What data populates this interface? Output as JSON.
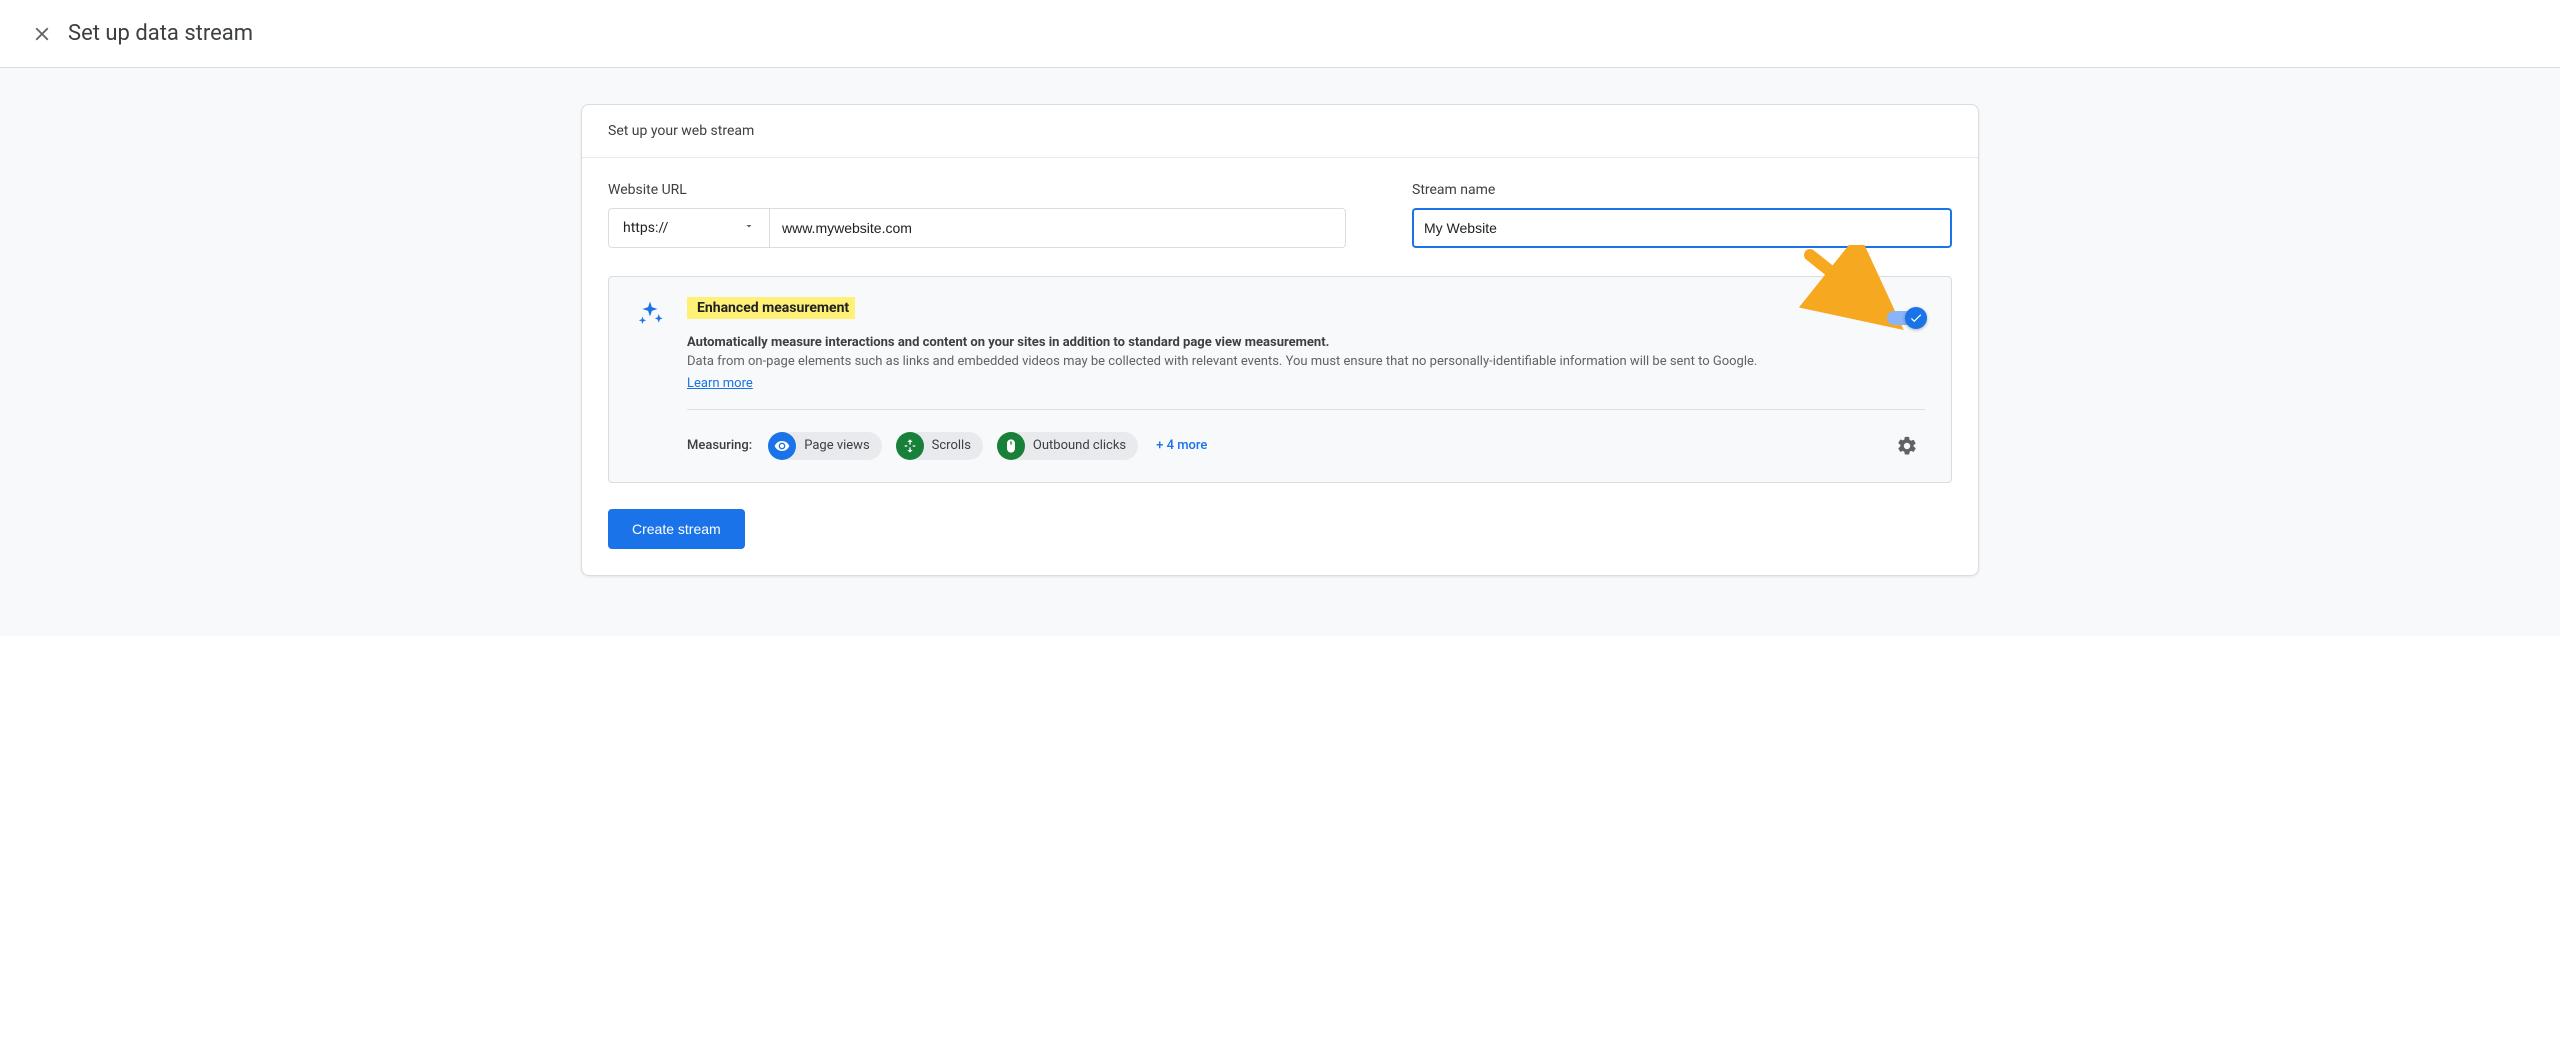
{
  "header": {
    "title": "Set up data stream"
  },
  "card": {
    "section_title": "Set up your web stream"
  },
  "url_field": {
    "label": "Website URL",
    "protocol": "https://",
    "value": "www.mywebsite.com"
  },
  "name_field": {
    "label": "Stream name",
    "value": "My Website"
  },
  "enhanced": {
    "title": "Enhanced measurement",
    "desc_bold": "Automatically measure interactions and content on your sites in addition to standard page view measurement.",
    "desc": "Data from on-page elements such as links and embedded videos may be collected with relevant events. You must ensure that no personally-identifiable information will be sent to Google.",
    "learn_more": "Learn more",
    "measuring_label": "Measuring:",
    "chips": {
      "page_views": "Page views",
      "scrolls": "Scrolls",
      "outbound": "Outbound clicks"
    },
    "more": "+ 4 more",
    "toggle_on": true
  },
  "create_button": "Create stream"
}
